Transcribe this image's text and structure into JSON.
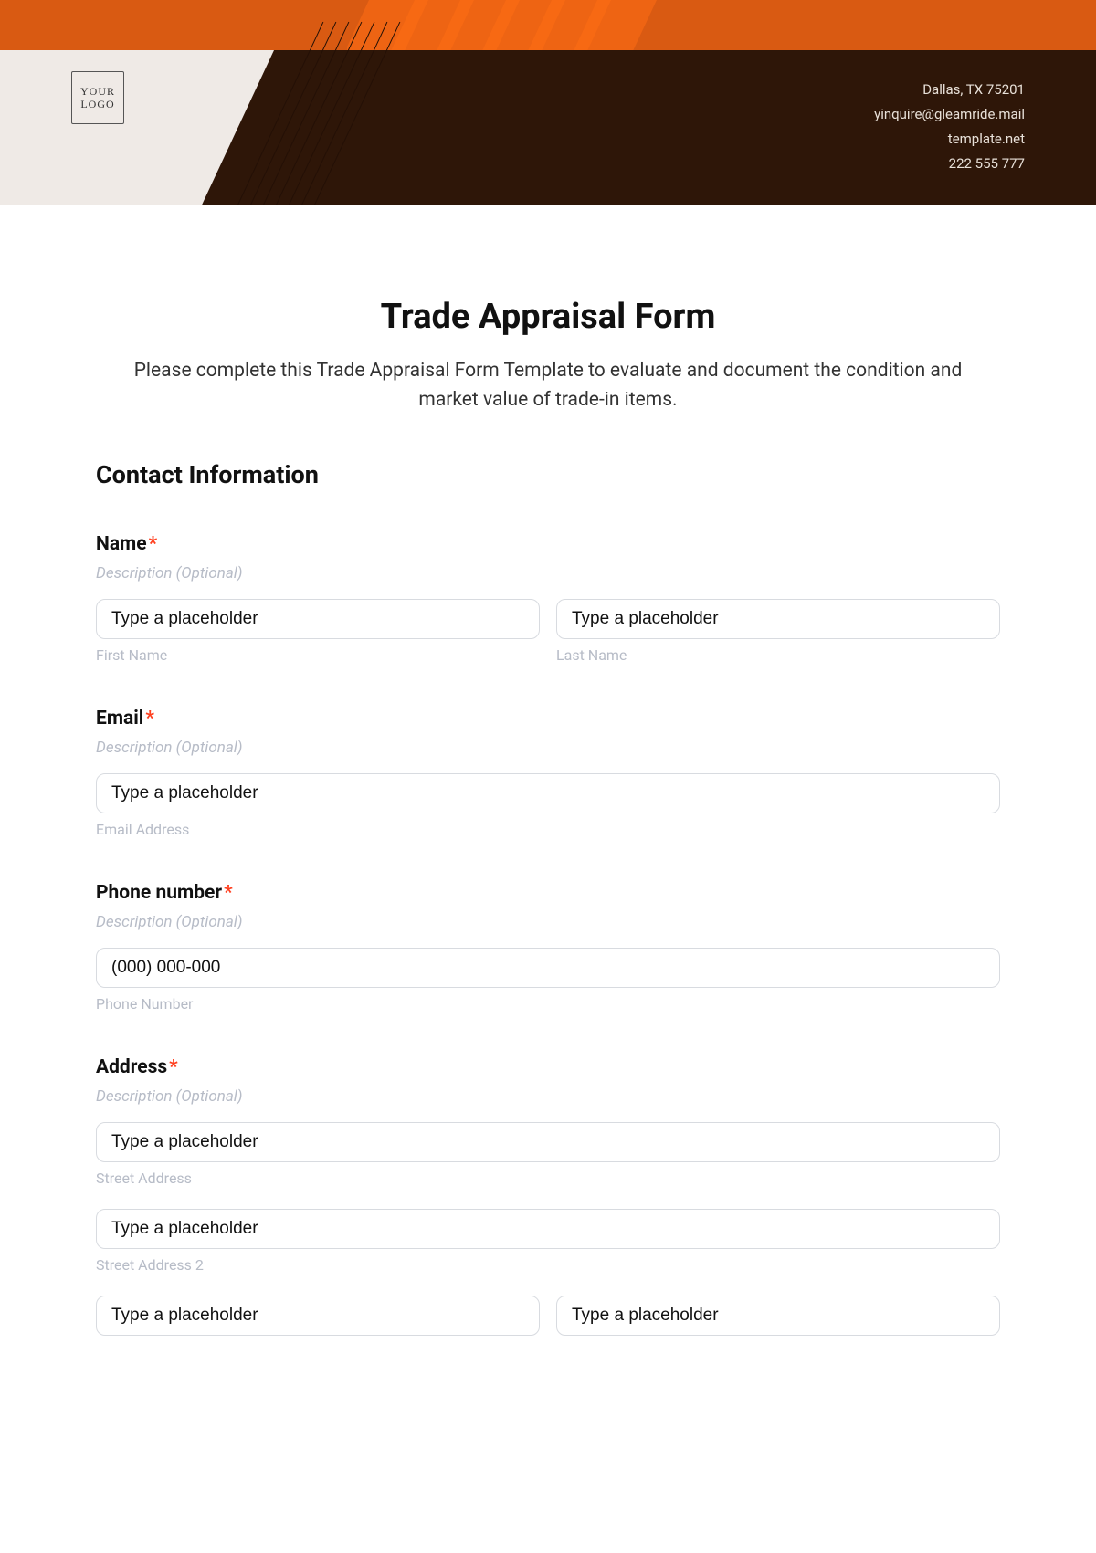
{
  "header": {
    "logo_text": "YOUR LOGO",
    "info_lines": [
      "Dallas, TX 75201",
      "yinquire@gleamride.mail",
      "template.net",
      "222 555 777"
    ]
  },
  "form": {
    "title": "Trade Appraisal Form",
    "description": "Please complete this Trade Appraisal Form Template to evaluate and document the condition and market value of trade-in items.",
    "section_heading": "Contact Information",
    "desc_optional": "Description (Optional)",
    "required_mark": "*",
    "placeholder_generic": "Type a placeholder",
    "fields": {
      "name": {
        "label": "Name",
        "first_sub": "First Name",
        "last_sub": "Last Name"
      },
      "email": {
        "label": "Email",
        "sub": "Email Address"
      },
      "phone": {
        "label": "Phone number",
        "placeholder": "(000) 000-000",
        "sub": "Phone Number"
      },
      "address": {
        "label": "Address",
        "street1_sub": "Street Address",
        "street2_sub": "Street Address 2"
      }
    }
  }
}
